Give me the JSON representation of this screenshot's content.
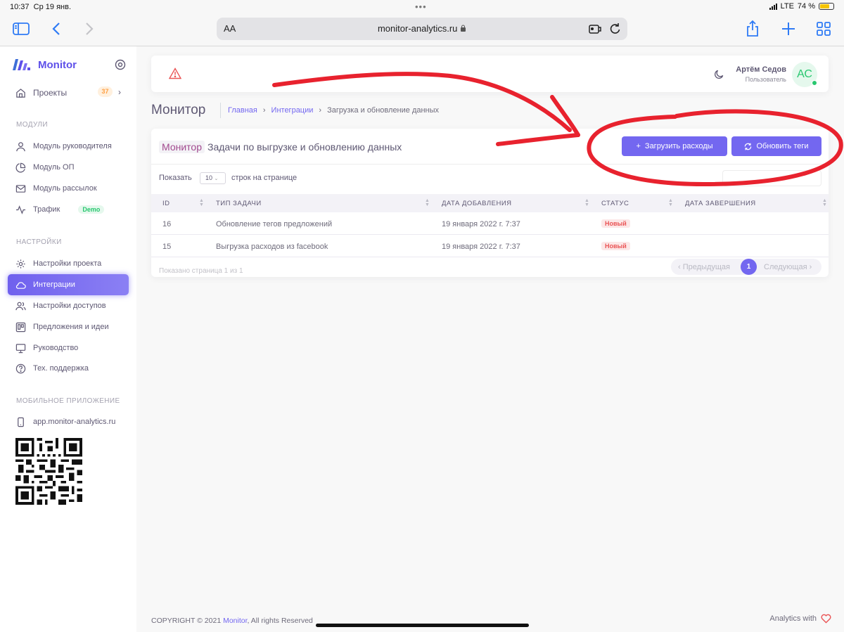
{
  "status_bar": {
    "time": "10:37",
    "date": "Ср 19 янв.",
    "network": "LTE",
    "battery": "74 %",
    "battery_level": 0.74,
    "battery_color": "#f5c400"
  },
  "browser": {
    "text_size_label": "AA",
    "url": "monitor-analytics.ru"
  },
  "sidebar": {
    "brand": "Monitor",
    "projects_label": "Проекты",
    "projects_count": "37",
    "section_modules": "МОДУЛИ",
    "modules": [
      {
        "label": "Модуль руководителя",
        "icon": "user-icon"
      },
      {
        "label": "Модуль ОП",
        "icon": "pie-chart-icon"
      },
      {
        "label": "Модуль рассылок",
        "icon": "mail-icon"
      },
      {
        "label": "Трафик",
        "icon": "activity-icon",
        "badge": "Demo"
      }
    ],
    "section_settings": "НАСТРОЙКИ",
    "settings": [
      {
        "label": "Настройки проекта",
        "icon": "settings-icon"
      },
      {
        "label": "Интеграции",
        "icon": "cloud-icon",
        "active": true
      },
      {
        "label": "Настройки доступов",
        "icon": "users-icon"
      },
      {
        "label": "Предложения и идеи",
        "icon": "trello-icon"
      },
      {
        "label": "Руководство",
        "icon": "monitor-icon"
      },
      {
        "label": "Тех. поддержка",
        "icon": "help-circle-icon"
      }
    ],
    "section_mobile": "МОБИЛЬНОЕ ПРИЛОЖЕНИЕ",
    "mobile_link": "app.monitor-analytics.ru"
  },
  "topnav": {
    "user_name": "Артём Седов",
    "user_role": "Пользователь",
    "avatar_initials": "АС"
  },
  "page": {
    "title": "Монитор",
    "breadcrumb": [
      "Главная",
      "Интеграции",
      "Загрузка и обновление данных"
    ]
  },
  "card": {
    "title_tag": "Монитор",
    "title": "Задачи по выгрузке и обновлению данных",
    "btn_upload": "Загрузить расходы",
    "btn_refresh": "Обновить теги",
    "show_label": "Показать",
    "page_length": "10",
    "rows_label": "строк на странице",
    "columns": [
      "ID",
      "ТИП ЗАДАЧИ",
      "ДАТА ДОБАВЛЕНИЯ",
      "СТАТУС",
      "ДАТА ЗАВЕРШЕНИЯ"
    ],
    "rows": [
      {
        "id": "16",
        "type": "Обновление тегов предложений",
        "added": "19 января 2022 г. 7:37",
        "status": "Новый",
        "completed": ""
      },
      {
        "id": "15",
        "type": "Выгрузка расходов из facebook",
        "added": "19 января 2022 г. 7:37",
        "status": "Новый",
        "completed": ""
      }
    ],
    "info": "Показано страница 1 из 1",
    "prev_label": "Предыдущая",
    "current_page": "1",
    "next_label": "Следующая"
  },
  "footer": {
    "copyright": "COPYRIGHT © 2021 ",
    "brand": "Monitor",
    "rights": ", All rights Reserved",
    "right_text": "Analytics with"
  },
  "colors": {
    "primary": "#7367f0",
    "success": "#28c76f",
    "danger": "#ea5455",
    "warning": "#ff9f43",
    "annotation": "#e8222e"
  }
}
